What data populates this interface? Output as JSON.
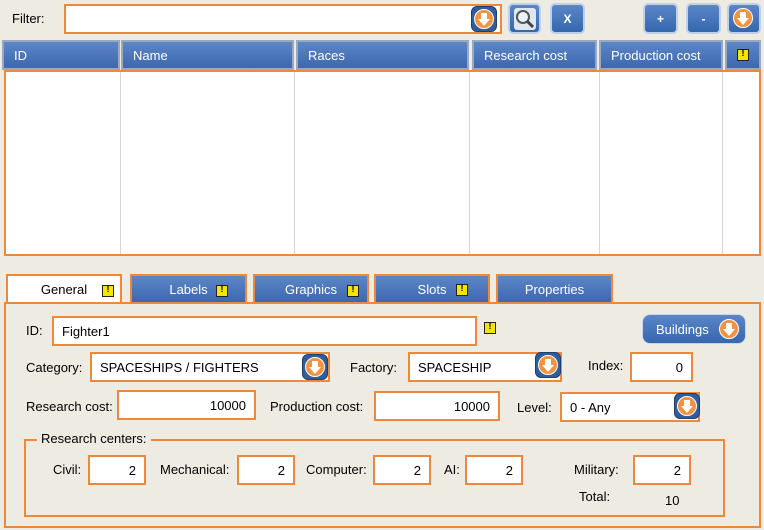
{
  "filter": {
    "label": "Filter:",
    "value": ""
  },
  "toolbar": {
    "clear_label": "X",
    "add_label": "+",
    "remove_label": "-"
  },
  "table": {
    "columns": [
      "ID",
      "Name",
      "Races",
      "Research cost",
      "Production cost",
      ""
    ]
  },
  "tabs": [
    "General",
    "Labels",
    "Graphics",
    "Slots",
    "Properties"
  ],
  "general": {
    "id_label": "ID:",
    "id_value": "Fighter1",
    "buildings_label": "Buildings",
    "category_label": "Category:",
    "category_value": "SPACESHIPS / FIGHTERS",
    "factory_label": "Factory:",
    "factory_value": "SPACESHIP",
    "index_label": "Index:",
    "index_value": "0",
    "research_cost_label": "Research cost:",
    "research_cost_value": "10000",
    "production_cost_label": "Production cost:",
    "production_cost_value": "10000",
    "level_label": "Level:",
    "level_value": "0 - Any",
    "research_centers": {
      "legend": "Research centers:",
      "civil_label": "Civil:",
      "civil_value": "2",
      "mechanical_label": "Mechanical:",
      "mechanical_value": "2",
      "computer_label": "Computer:",
      "computer_value": "2",
      "ai_label": "AI:",
      "ai_value": "2",
      "military_label": "Military:",
      "military_value": "2",
      "total_label": "Total:",
      "total_value": "10"
    }
  },
  "colors": {
    "accent": "#f0883a",
    "blue": "#3d68b0",
    "background": "#eeebe3",
    "warning": "#f5e400"
  },
  "icons": [
    "dropdown-arrow-icon",
    "search-icon",
    "warning-icon"
  ]
}
